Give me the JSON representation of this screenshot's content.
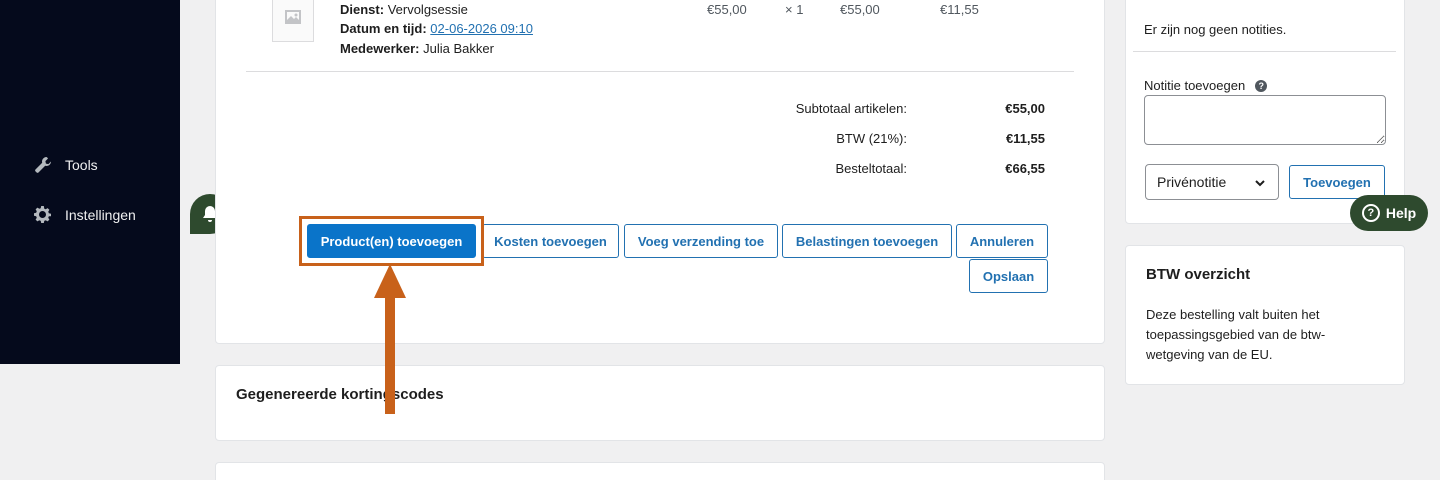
{
  "sidebar": {
    "items": [
      {
        "label": "Tools",
        "icon": "wrench-icon"
      },
      {
        "label": "Instellingen",
        "icon": "gear-icon"
      }
    ]
  },
  "order_item": {
    "service_label": "Dienst:",
    "service_value": "Vervolgsessie",
    "datetime_label": "Datum en tijd:",
    "datetime_value": "02-06-2026 09:10",
    "employee_label": "Medewerker:",
    "employee_value": "Julia Bakker",
    "unit_price": "€55,00",
    "quantity": "× 1",
    "line_total": "€55,00",
    "line_tax": "€11,55"
  },
  "totals": {
    "subtotal_label": "Subtotaal artikelen:",
    "subtotal_value": "€55,00",
    "vat_label": "BTW (21%):",
    "vat_value": "€11,55",
    "order_total_label": "Besteltotaal:",
    "order_total_value": "€66,55"
  },
  "actions": {
    "add_products": "Product(en) toevoegen",
    "add_costs": "Kosten toevoegen",
    "add_shipping": "Voeg verzending toe",
    "add_taxes": "Belastingen toevoegen",
    "cancel": "Annuleren",
    "save": "Opslaan"
  },
  "coupons": {
    "title": "Gegenereerde kortingscodes"
  },
  "notes": {
    "empty_text": "Er zijn nog geen notities.",
    "add_label": "Notitie toevoegen",
    "note_type_selected": "Privénotitie",
    "add_button": "Toevoegen"
  },
  "help": {
    "label": "Help"
  },
  "vat_overview": {
    "title": "BTW overzicht",
    "text": "Deze bestelling valt buiten het toepassingsgebied van de btw-wetgeving van de EU."
  },
  "colors": {
    "primary": "#0a74c9",
    "annotation": "#c8611a",
    "help_bg": "#2e4a2e",
    "sidebar_bg": "#050a1c"
  }
}
